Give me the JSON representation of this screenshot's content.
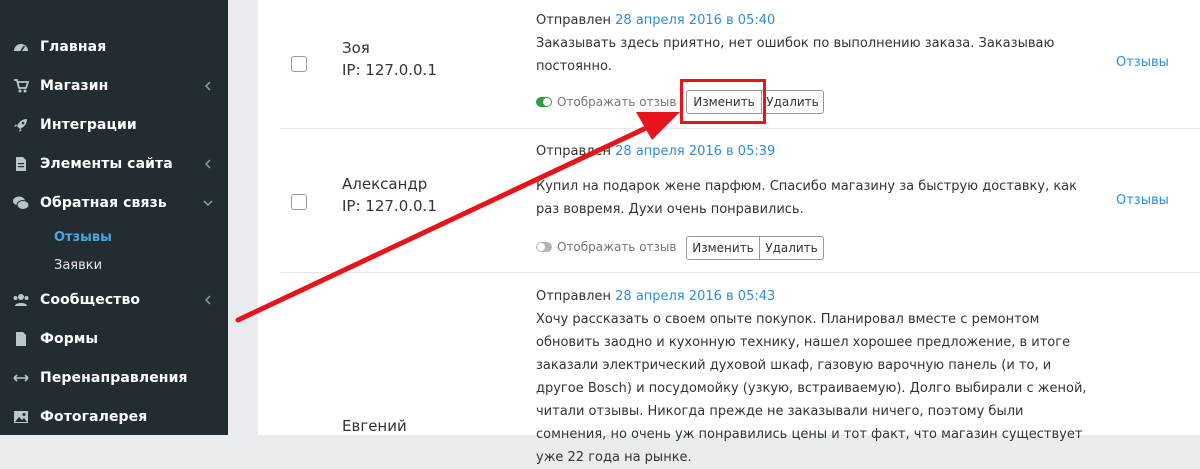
{
  "sidebar": {
    "items": [
      {
        "label": "Главная",
        "icon": "dashboard-icon"
      },
      {
        "label": "Магазин",
        "icon": "cart-icon",
        "chevron": "left"
      },
      {
        "label": "Интеграции",
        "icon": "rocket-icon"
      },
      {
        "label": "Элементы сайта",
        "icon": "file-icon",
        "chevron": "left"
      },
      {
        "label": "Обратная связь",
        "icon": "comments-icon",
        "chevron": "down"
      },
      {
        "label": "Сообщество",
        "icon": "users-icon",
        "chevron": "left"
      },
      {
        "label": "Формы",
        "icon": "file-icon"
      },
      {
        "label": "Перенаправления",
        "icon": "arrows-h-icon"
      },
      {
        "label": "Фотогалерея",
        "icon": "picture-icon"
      }
    ],
    "subitems": [
      {
        "label": "Отзывы",
        "active": true
      },
      {
        "label": "Заявки",
        "active": false
      }
    ]
  },
  "reviews": [
    {
      "author": "Зоя",
      "ip": "IP: 127.0.0.1",
      "sent_prefix": "Отправлен",
      "sent_date": "28 апреля 2016 в 05:40",
      "text": "Заказывать здесь приятно, нет ошибок по выполнению заказа. Заказываю постоянно.",
      "toggle_label": "Отображать отзыв",
      "toggle_on": true,
      "edit_label": "Изменить",
      "delete_label": "Удалить",
      "link": "Отзывы"
    },
    {
      "author": "Александр",
      "ip": "IP: 127.0.0.1",
      "sent_prefix": "Отправлен",
      "sent_date": "28 апреля 2016 в 05:39",
      "text": "Купил на подарок жене парфюм. Спасибо магазину за быструю доставку, как раз вовремя. Духи очень понравились.",
      "toggle_label": "Отображать отзыв",
      "toggle_on": false,
      "edit_label": "Изменить",
      "delete_label": "Удалить",
      "link": "Отзывы"
    },
    {
      "author": "Евгений",
      "sent_prefix": "Отправлен",
      "sent_date": "28 апреля 2016 в 05:43",
      "text": "Хочу рассказать о своем опыте покупок. Планировал вместе с ремонтом обновить заодно и кухонную технику, нашел хорошее предложение, в итоге заказали электрический духовой шкаф, газовую варочную панель (и то, и другое Bosch) и посудомойку (узкую, встраиваемую). Долго выбирали с женой, читали отзывы. Никогда прежде не заказывали ничего, поэтому были сомнения, но очень уж понравились цены и тот факт, что магазин существует уже 22 года на рынке."
    }
  ],
  "colors": {
    "sidebar_bg": "#222d32",
    "link": "#2d8ed6",
    "annotation": "#e8141c",
    "toggle_on": "#2e9f3e"
  }
}
